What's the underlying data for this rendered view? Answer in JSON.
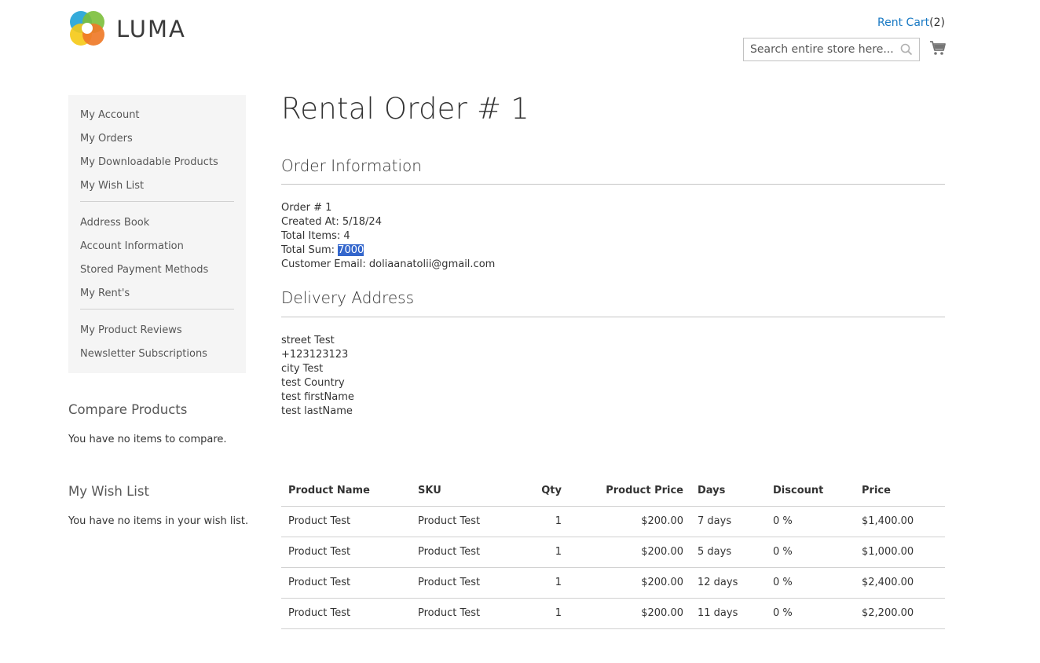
{
  "header": {
    "logo_text": "LUMA",
    "rent_cart_label": "Rent Cart",
    "rent_cart_count": "(2)",
    "search_placeholder": "Search entire store here..."
  },
  "sidebar": {
    "nav_groups": [
      [
        "My Account",
        "My Orders",
        "My Downloadable Products",
        "My Wish List"
      ],
      [
        "Address Book",
        "Account Information",
        "Stored Payment Methods",
        "My Rent's"
      ],
      [
        "My Product Reviews",
        "Newsletter Subscriptions"
      ]
    ],
    "compare": {
      "title": "Compare Products",
      "empty_text": "You have no items to compare."
    },
    "wishlist": {
      "title": "My Wish List",
      "empty_text": "You have no items in your wish list."
    }
  },
  "main": {
    "page_title": "Rental Order # 1",
    "order_info": {
      "title": "Order Information",
      "order_number": "Order # 1",
      "created_at": "Created At: 5/18/24",
      "total_items": "Total Items: 4",
      "total_sum_label": "Total Sum: ",
      "total_sum_value": "7000",
      "customer_email": "Customer Email: doliaanatolii@gmail.com"
    },
    "delivery": {
      "title": "Delivery Address",
      "lines": [
        "street Test",
        "+123123123",
        "city Test",
        "test Country",
        "test firstName",
        "test lastName"
      ]
    },
    "table": {
      "columns": [
        "Product Name",
        "SKU",
        "Qty",
        "Product Price",
        "Days",
        "Discount",
        "Price"
      ],
      "rows": [
        [
          "Product Test",
          "Product Test",
          "1",
          "$200.00",
          "7 days",
          "0 %",
          "$1,400.00"
        ],
        [
          "Product Test",
          "Product Test",
          "1",
          "$200.00",
          "5 days",
          "0 %",
          "$1,000.00"
        ],
        [
          "Product Test",
          "Product Test",
          "1",
          "$200.00",
          "12 days",
          "0 %",
          "$2,400.00"
        ],
        [
          "Product Test",
          "Product Test",
          "1",
          "$200.00",
          "11 days",
          "0 %",
          "$2,200.00"
        ]
      ]
    }
  }
}
